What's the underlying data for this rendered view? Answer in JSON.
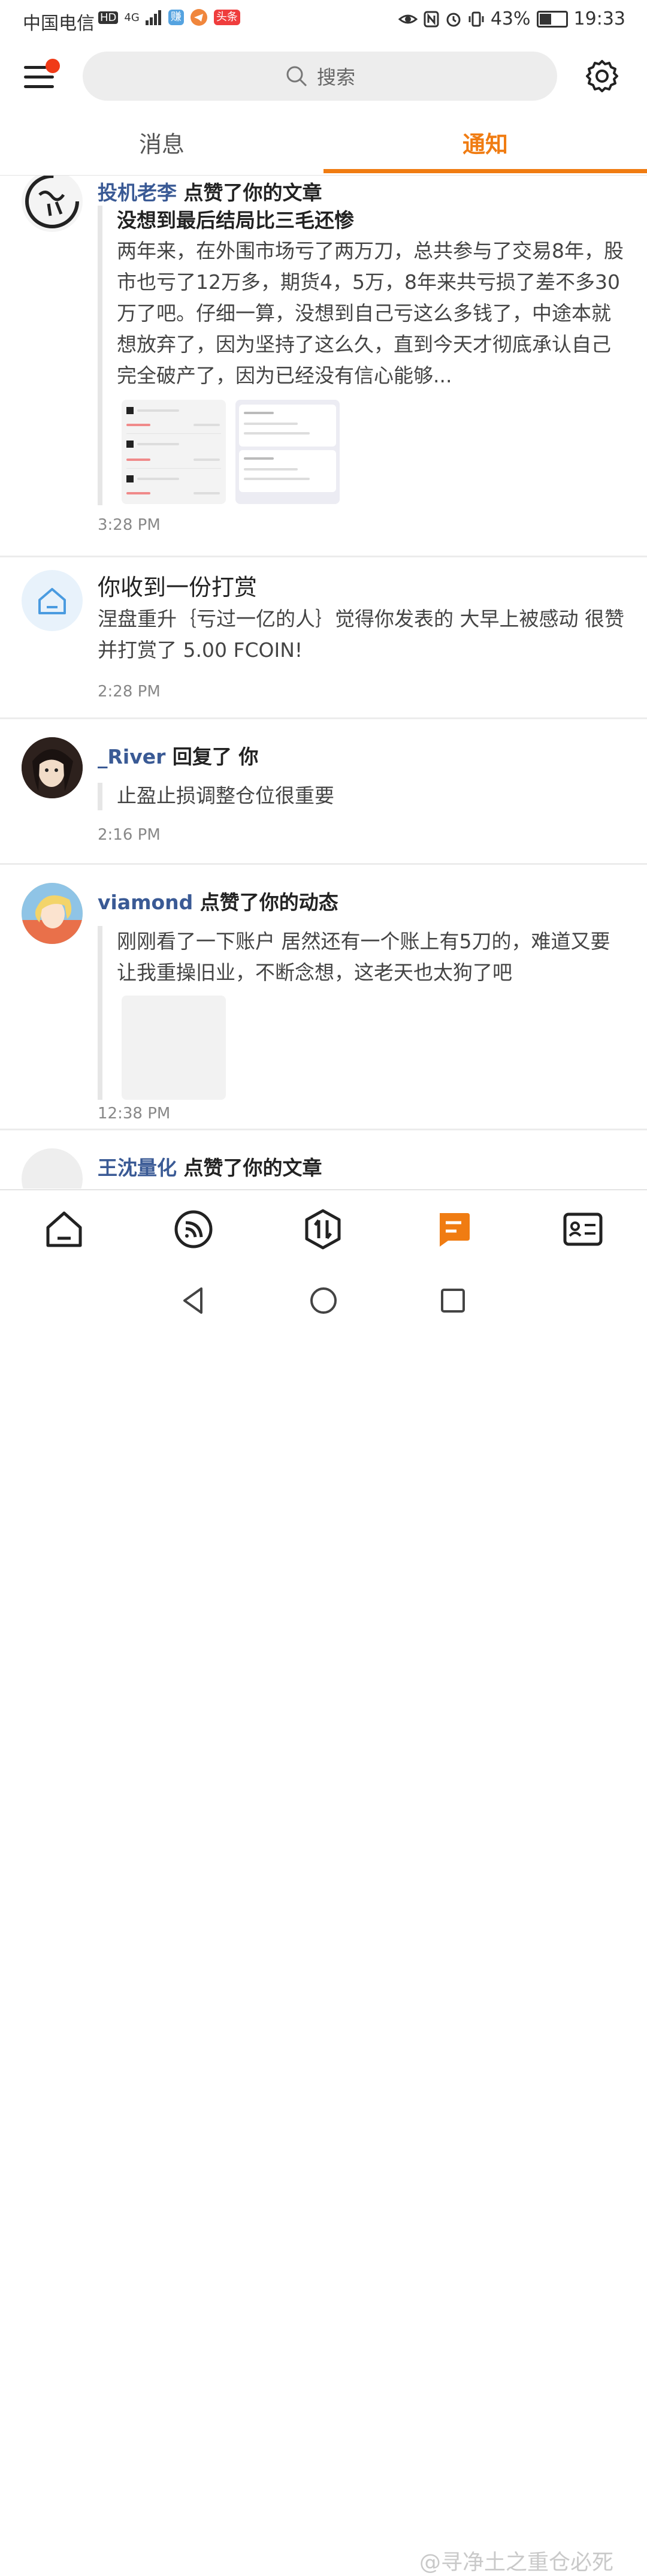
{
  "status_bar": {
    "carrier": "中国电信",
    "hd": "HD",
    "network": "4G",
    "chip_labels": [
      "赚",
      "头条"
    ],
    "battery_percent_text": "43%",
    "battery_level": 0.43,
    "time": "19:33"
  },
  "search": {
    "placeholder": "搜索"
  },
  "tabs": {
    "messages": "消息",
    "notifications": "通知",
    "active": "notifications"
  },
  "colors": {
    "accent": "#f07c12",
    "username": "#3a5a95",
    "badge": "#f03a17"
  },
  "feed": {
    "items": [
      {
        "user": "投机老李",
        "action": "点赞了你的文章",
        "title": "没想到最后结局比三毛还惨",
        "text": "两年来，在外围市场亏了两万刀，总共参与了交易8年，股市也亏了12万多，期货4，5万，8年来共亏损了差不多30万了吧。仔细一算，没想到自己亏这么多钱了，中途本就想放弃了，因为坚持了这么久，直到今天才彻底承认自己完全破产了，因为已经没有信心能够...",
        "time": "3:28 PM",
        "thumbs": [
          {
            "amounts": [
              "-303.91 USD",
              "-271.31 USD",
              "-3,030.15 USD"
            ]
          },
          {
            "amounts": [
              "36,420.08",
              "36,080.08"
            ]
          }
        ]
      },
      {
        "title": "你收到一份打赏",
        "sender": "涅盘重升",
        "text_part1": "｛亏过一亿的人｝觉得你发表的",
        "article": "大早上被感动",
        "text_part2": "很赞并打赏了",
        "amount": "5.00 FCOIN",
        "exclaim": "!",
        "time": "2:28 PM"
      },
      {
        "user": "_River",
        "action": "回复了 你",
        "text": "止盈止损调整仓位很重要",
        "time": "2:16 PM"
      },
      {
        "user": "viamond",
        "action": "点赞了你的动态",
        "text": "刚刚看了一下账户 居然还有一个账上有5刀的，难道又要让我重操旧业，不断念想，这老天也太狗了吧",
        "time": "12:38 PM"
      },
      {
        "user": "王沈量化",
        "action": "点赞了你的文章"
      }
    ]
  },
  "watermark": "@寻净土之重仓必死"
}
